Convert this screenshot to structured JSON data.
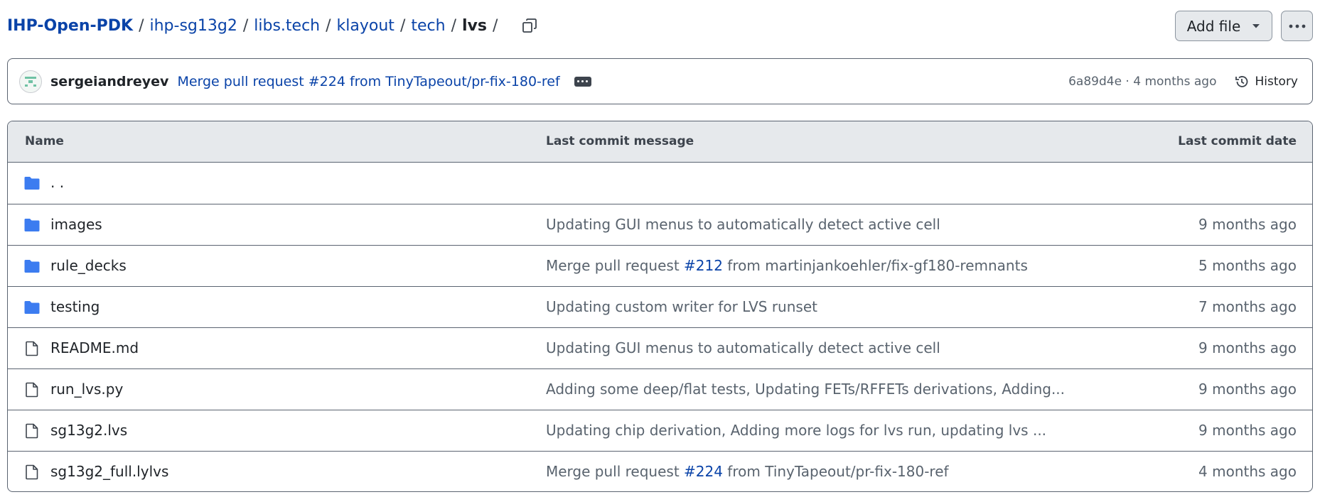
{
  "breadcrumb": {
    "items": [
      "IHP-Open-PDK",
      "ihp-sg13g2",
      "libs.tech",
      "klayout",
      "tech"
    ],
    "current": "lvs",
    "separator": "/"
  },
  "actions": {
    "add_file_label": "Add file",
    "more_icon": "kebab-horizontal-icon"
  },
  "latest_commit": {
    "author": "sergeiandreyev",
    "message": "Merge pull request #224 from TinyTapeout/pr-fix-180-ref",
    "meta": "6a89d4e · 4 months ago",
    "history_label": "History"
  },
  "table": {
    "headers": {
      "name": "Name",
      "message": "Last commit message",
      "date": "Last commit date"
    },
    "parent": {
      "name": ". .",
      "icon": "folder-icon"
    },
    "rows": [
      {
        "type": "dir",
        "icon": "folder-icon",
        "name": "images",
        "message_text": "Updating GUI menus to automatically detect active cell",
        "date": "9 months ago"
      },
      {
        "type": "dir",
        "icon": "folder-icon",
        "name": "rule_decks",
        "message_pre": "Merge pull request ",
        "message_link": "#212",
        "message_post": " from martinjankoehler/fix-gf180-remnants",
        "date": "5 months ago"
      },
      {
        "type": "dir",
        "icon": "folder-icon",
        "name": "testing",
        "message_text": "Updating custom writer for LVS runset",
        "date": "7 months ago"
      },
      {
        "type": "file",
        "icon": "file-icon",
        "name": "README.md",
        "message_text": "Updating GUI menus to automatically detect active cell",
        "date": "9 months ago"
      },
      {
        "type": "file",
        "icon": "file-icon",
        "name": "run_lvs.py",
        "message_text": "Adding some deep/flat tests, Updating FETs/RFFETs derivations, Adding...",
        "date": "9 months ago"
      },
      {
        "type": "file",
        "icon": "file-icon",
        "name": "sg13g2.lvs",
        "message_text": "Updating chip derivation, Adding more logs for lvs run, updating lvs ...",
        "date": "9 months ago"
      },
      {
        "type": "file",
        "icon": "file-icon",
        "name": "sg13g2_full.lylvs",
        "message_pre": "Merge pull request ",
        "message_link": "#224",
        "message_post": " from TinyTapeout/pr-fix-180-ref",
        "date": "4 months ago"
      }
    ]
  },
  "colors": {
    "link": "#0a43a8",
    "folder": "#3c7cf0",
    "border": "#5a6370",
    "header_bg": "#e6e9ec"
  }
}
